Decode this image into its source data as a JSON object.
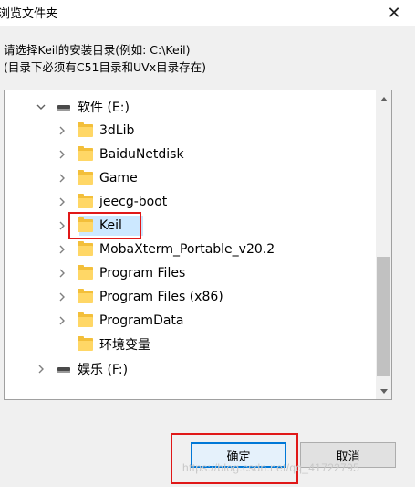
{
  "window": {
    "title": "浏览文件夹",
    "close_glyph": "✕"
  },
  "instructions": {
    "line1": "请选择Keil的安装目录(例如: C:\\Keil)",
    "line2": "(目录下必须有C51目录和UVx目录存在)"
  },
  "tree": {
    "drive_e": "软件 (E:)",
    "folders": [
      {
        "label": "3dLib",
        "has_children": true
      },
      {
        "label": "BaiduNetdisk",
        "has_children": true
      },
      {
        "label": "Game",
        "has_children": true
      },
      {
        "label": "jeecg-boot",
        "has_children": true
      },
      {
        "label": "Keil",
        "has_children": true,
        "selected": true
      },
      {
        "label": "MobaXterm_Portable_v20.2",
        "has_children": true
      },
      {
        "label": "Program Files",
        "has_children": true
      },
      {
        "label": "Program Files (x86)",
        "has_children": true
      },
      {
        "label": "ProgramData",
        "has_children": true
      },
      {
        "label": "环境变量",
        "has_children": false
      }
    ],
    "drive_f": "娱乐 (F:)"
  },
  "buttons": {
    "ok_label": "确定",
    "cancel_label": "取消"
  },
  "watermark": "https://blog.csdn.net/qq_41722795",
  "colors": {
    "selection": "#cce8ff",
    "highlight_box": "#e01818",
    "ok_border": "#0078d7"
  }
}
